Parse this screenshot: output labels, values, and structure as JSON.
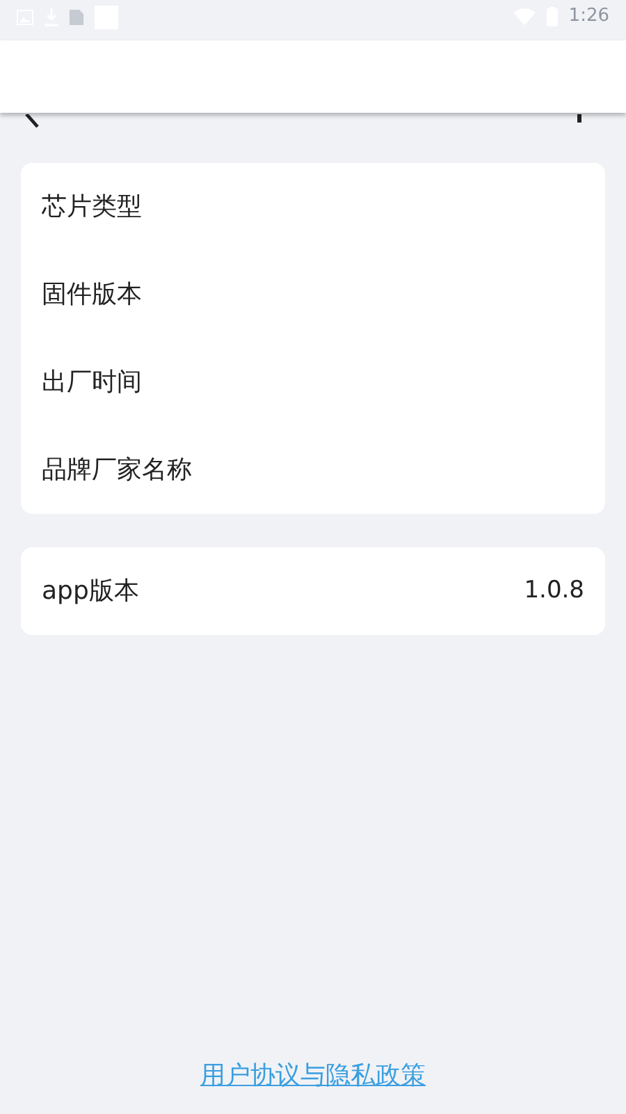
{
  "status_bar": {
    "time": "1:26"
  },
  "info_items": [
    {
      "label": "芯片类型"
    },
    {
      "label": "固件版本"
    },
    {
      "label": "出厂时间"
    },
    {
      "label": "品牌厂家名称"
    }
  ],
  "app_version": {
    "label": "app版本",
    "value": "1.0.8"
  },
  "footer_link": "用户协议与隐私政策"
}
